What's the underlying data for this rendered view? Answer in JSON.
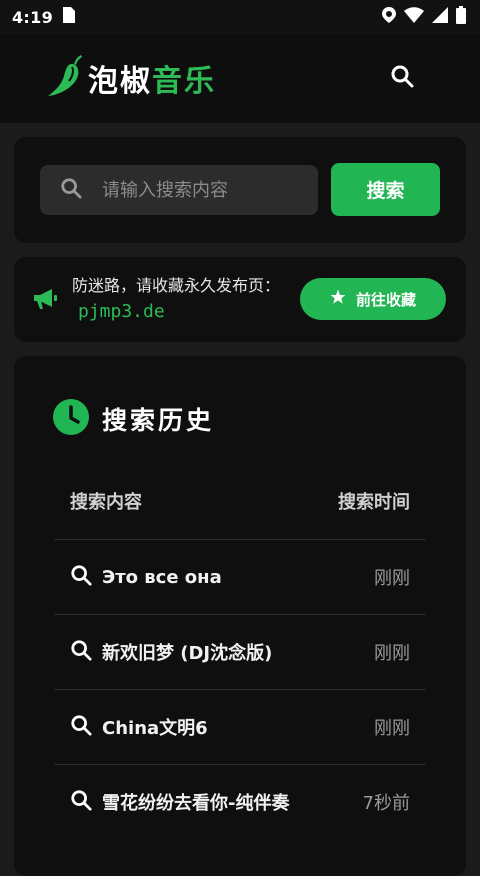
{
  "status_bar": {
    "time": "4:19"
  },
  "header": {
    "brand_part1": "泡椒",
    "brand_part2": "音乐"
  },
  "search": {
    "placeholder": "请输入搜索内容",
    "button_label": "搜索"
  },
  "notice": {
    "text": "防迷路，请收藏永久发布页：",
    "link": "pjmp3.de",
    "button_label": "前往收藏"
  },
  "history": {
    "title": "搜索历史",
    "col_content": "搜索内容",
    "col_time": "搜索时间",
    "items": [
      {
        "query": "Это все она",
        "time": "刚刚"
      },
      {
        "query": "新欢旧梦 (DJ沈念版)",
        "time": "刚刚"
      },
      {
        "query": "China文明6",
        "time": "刚刚"
      },
      {
        "query": "雪花纷纷去看你-纯伴奏",
        "time": "7秒前"
      }
    ]
  },
  "colors": {
    "accent": "#21b553",
    "background": "#1b1b1b",
    "card": "#0f0f0f"
  }
}
